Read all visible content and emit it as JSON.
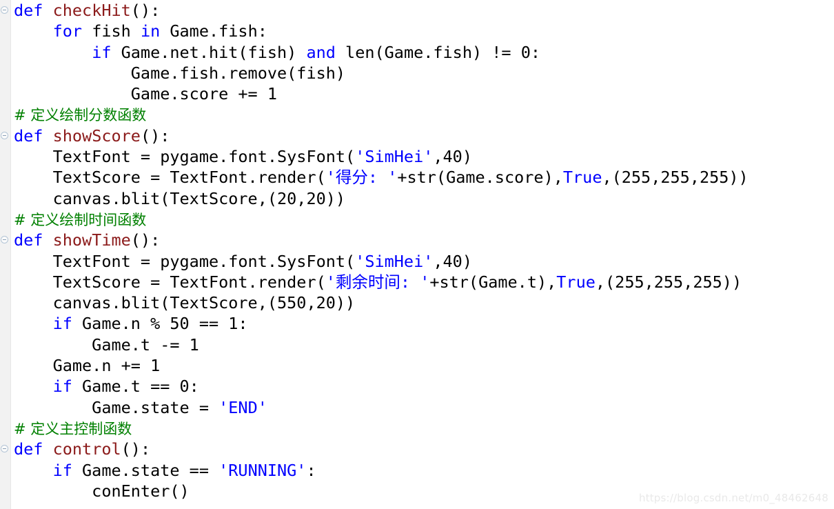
{
  "editor": {
    "language": "Python",
    "background_color": "#ffffff",
    "gutter_color": "#f2f2f2",
    "colors": {
      "keyword": "#0000ff",
      "function_name": "#8b1a1a",
      "comment": "#008000",
      "string": "#0000ff",
      "default_text": "#000000",
      "watermark": "#e9e9e9"
    }
  },
  "watermark": {
    "text": "https://blog.csdn.net/m0_48462648"
  },
  "lines": [
    {
      "fold_marker": true,
      "tokens": [
        {
          "t": "def",
          "c": "kw"
        },
        {
          "t": " ",
          "c": "plain"
        },
        {
          "t": "checkHit",
          "c": "fn"
        },
        {
          "t": "():",
          "c": "plain"
        }
      ]
    },
    {
      "fold_marker": false,
      "tokens": [
        {
          "t": "    ",
          "c": "plain"
        },
        {
          "t": "for",
          "c": "kw"
        },
        {
          "t": " fish ",
          "c": "plain"
        },
        {
          "t": "in",
          "c": "kw"
        },
        {
          "t": " Game.fish:",
          "c": "plain"
        }
      ]
    },
    {
      "fold_marker": false,
      "tokens": [
        {
          "t": "        ",
          "c": "plain"
        },
        {
          "t": "if",
          "c": "kw"
        },
        {
          "t": " Game.net.hit(fish) ",
          "c": "plain"
        },
        {
          "t": "and",
          "c": "kw"
        },
        {
          "t": " len(Game.fish) != 0:",
          "c": "plain"
        }
      ]
    },
    {
      "fold_marker": false,
      "tokens": [
        {
          "t": "            Game.fish.remove(fish)",
          "c": "plain"
        }
      ]
    },
    {
      "fold_marker": false,
      "tokens": [
        {
          "t": "            Game.score += 1",
          "c": "plain"
        }
      ]
    },
    {
      "fold_marker": false,
      "tokens": [
        {
          "t": "# 定义绘制分数函数",
          "c": "cm"
        }
      ]
    },
    {
      "fold_marker": true,
      "tokens": [
        {
          "t": "def",
          "c": "kw"
        },
        {
          "t": " ",
          "c": "plain"
        },
        {
          "t": "showScore",
          "c": "fn"
        },
        {
          "t": "():",
          "c": "plain"
        }
      ]
    },
    {
      "fold_marker": false,
      "tokens": [
        {
          "t": "    TextFont = pygame.font.SysFont(",
          "c": "plain"
        },
        {
          "t": "'SimHei'",
          "c": "str"
        },
        {
          "t": ",40)",
          "c": "plain"
        }
      ]
    },
    {
      "fold_marker": false,
      "tokens": [
        {
          "t": "    TextScore = TextFont.render(",
          "c": "plain"
        },
        {
          "t": "'得分: '",
          "c": "str"
        },
        {
          "t": "+str(Game.score),",
          "c": "plain"
        },
        {
          "t": "True",
          "c": "kw"
        },
        {
          "t": ",(255,255,255))",
          "c": "plain"
        }
      ]
    },
    {
      "fold_marker": false,
      "tokens": [
        {
          "t": "    canvas.blit(TextScore,(20,20))",
          "c": "plain"
        }
      ]
    },
    {
      "fold_marker": false,
      "tokens": [
        {
          "t": "# 定义绘制时间函数",
          "c": "cm"
        }
      ]
    },
    {
      "fold_marker": true,
      "tokens": [
        {
          "t": "def",
          "c": "kw"
        },
        {
          "t": " ",
          "c": "plain"
        },
        {
          "t": "showTime",
          "c": "fn"
        },
        {
          "t": "():",
          "c": "plain"
        }
      ]
    },
    {
      "fold_marker": false,
      "tokens": [
        {
          "t": "    TextFont = pygame.font.SysFont(",
          "c": "plain"
        },
        {
          "t": "'SimHei'",
          "c": "str"
        },
        {
          "t": ",40)",
          "c": "plain"
        }
      ]
    },
    {
      "fold_marker": false,
      "tokens": [
        {
          "t": "    TextScore = TextFont.render(",
          "c": "plain"
        },
        {
          "t": "'剩余时间: '",
          "c": "str"
        },
        {
          "t": "+str(Game.t),",
          "c": "plain"
        },
        {
          "t": "True",
          "c": "kw"
        },
        {
          "t": ",(255,255,255))",
          "c": "plain"
        }
      ]
    },
    {
      "fold_marker": false,
      "tokens": [
        {
          "t": "    canvas.blit(TextScore,(550,20))",
          "c": "plain"
        }
      ]
    },
    {
      "fold_marker": false,
      "tokens": [
        {
          "t": "    ",
          "c": "plain"
        },
        {
          "t": "if",
          "c": "kw"
        },
        {
          "t": " Game.n % 50 == 1:",
          "c": "plain"
        }
      ]
    },
    {
      "fold_marker": false,
      "tokens": [
        {
          "t": "        Game.t -= 1",
          "c": "plain"
        }
      ]
    },
    {
      "fold_marker": false,
      "tokens": [
        {
          "t": "    Game.n += 1",
          "c": "plain"
        }
      ]
    },
    {
      "fold_marker": false,
      "tokens": [
        {
          "t": "    ",
          "c": "plain"
        },
        {
          "t": "if",
          "c": "kw"
        },
        {
          "t": " Game.t == 0:",
          "c": "plain"
        }
      ]
    },
    {
      "fold_marker": false,
      "tokens": [
        {
          "t": "        Game.state = ",
          "c": "plain"
        },
        {
          "t": "'END'",
          "c": "str"
        }
      ]
    },
    {
      "fold_marker": false,
      "tokens": [
        {
          "t": "# 定义主控制函数",
          "c": "cm"
        }
      ]
    },
    {
      "fold_marker": true,
      "tokens": [
        {
          "t": "def",
          "c": "kw"
        },
        {
          "t": " ",
          "c": "plain"
        },
        {
          "t": "control",
          "c": "fn"
        },
        {
          "t": "():",
          "c": "plain"
        }
      ]
    },
    {
      "fold_marker": false,
      "tokens": [
        {
          "t": "    ",
          "c": "plain"
        },
        {
          "t": "if",
          "c": "kw"
        },
        {
          "t": " Game.state == ",
          "c": "plain"
        },
        {
          "t": "'RUNNING'",
          "c": "str"
        },
        {
          "t": ":",
          "c": "plain"
        }
      ]
    },
    {
      "fold_marker": false,
      "tokens": [
        {
          "t": "        conEnter()",
          "c": "plain"
        }
      ]
    }
  ]
}
